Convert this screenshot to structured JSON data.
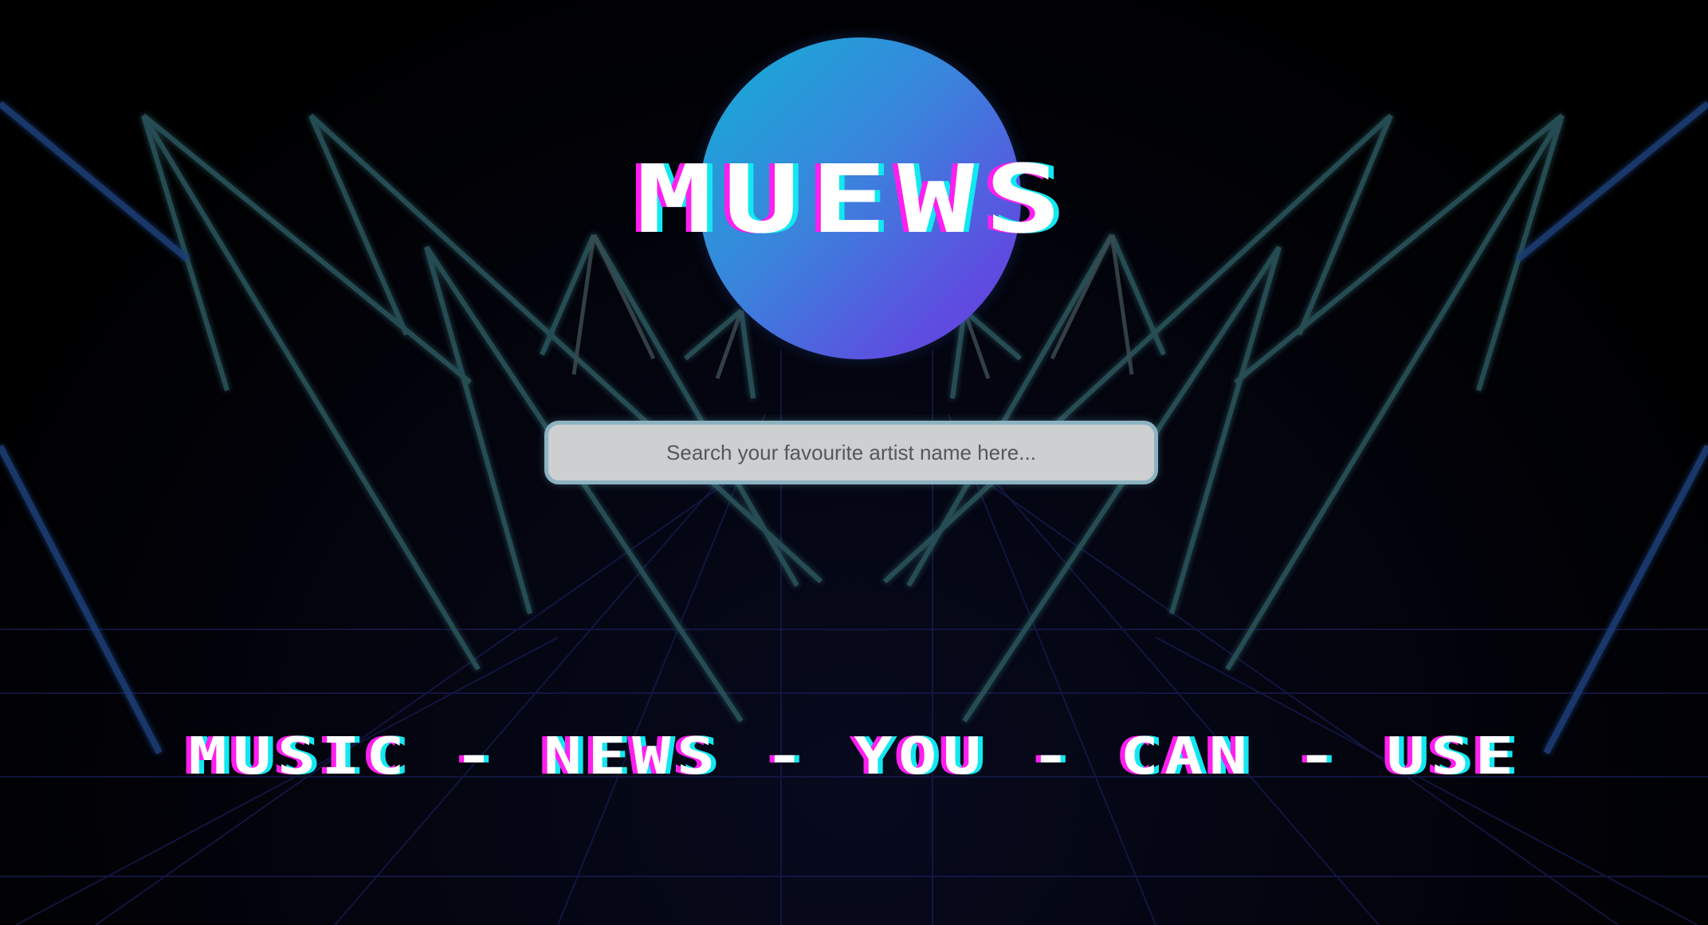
{
  "brand": {
    "title": "Muews",
    "logo_gradient": [
      "#12b0d6",
      "#6a3ae0"
    ]
  },
  "search": {
    "placeholder": "Search your favourite artist name here...",
    "value": ""
  },
  "tagline": {
    "text": "Music - News - You - Can - Use"
  },
  "theme": {
    "background": "#000000",
    "neon_teal": "#2f5f66",
    "neon_blue": "#1d3f7a",
    "grid_color": "#1a1f55",
    "glitch_pink": "#ff1ef0",
    "glitch_cyan": "#12e8f0"
  }
}
